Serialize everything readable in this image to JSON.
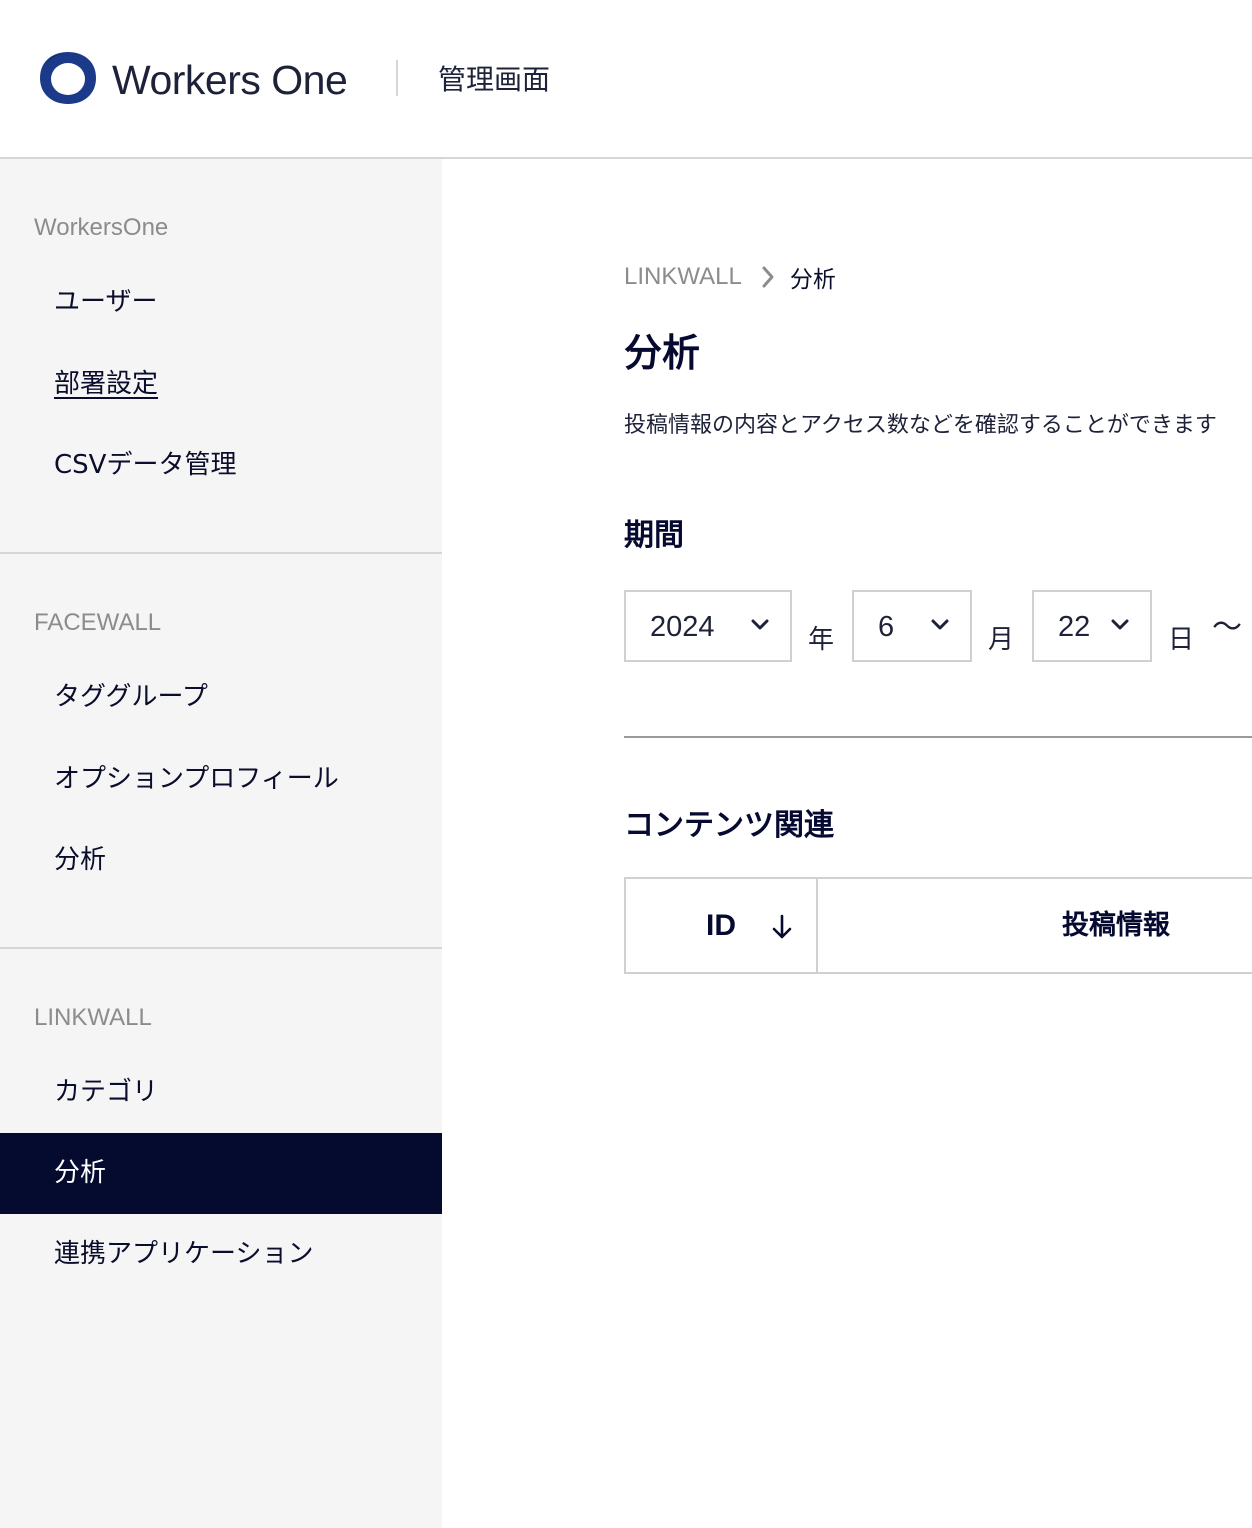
{
  "header": {
    "brand": "Workers One",
    "subtitle": "管理画面"
  },
  "sidebar": {
    "sections": [
      {
        "label": "WorkersOne",
        "items": [
          {
            "label": "ユーザー"
          },
          {
            "label": "部署設定"
          },
          {
            "label": "CSVデータ管理"
          }
        ]
      },
      {
        "label": "FACEWALL",
        "items": [
          {
            "label": "タググループ"
          },
          {
            "label": "オプションプロフィール"
          },
          {
            "label": "分析"
          }
        ]
      },
      {
        "label": "LINKWALL",
        "items": [
          {
            "label": "カテゴリ"
          },
          {
            "label": "分析",
            "active": true
          },
          {
            "label": "連携アプリケーション"
          }
        ]
      }
    ]
  },
  "main": {
    "breadcrumb": {
      "root": "LINKWALL",
      "current": "分析"
    },
    "title": "分析",
    "description": "投稿情報の内容とアクセス数などを確認することができます",
    "period": {
      "heading": "期間",
      "year": {
        "value": "2024",
        "unit": "年"
      },
      "month": {
        "value": "6",
        "unit": "月"
      },
      "day": {
        "value": "22",
        "unit": "日"
      },
      "range_separator": "〜"
    },
    "content": {
      "heading": "コンテンツ関連",
      "table": {
        "columns": [
          {
            "label": "ID",
            "sort": "desc"
          },
          {
            "label": "投稿情報"
          }
        ]
      }
    }
  },
  "colors": {
    "active_bg": "#050a2f",
    "brand_blue": "#1b3a8a",
    "sidebar_bg": "#f5f5f5"
  }
}
